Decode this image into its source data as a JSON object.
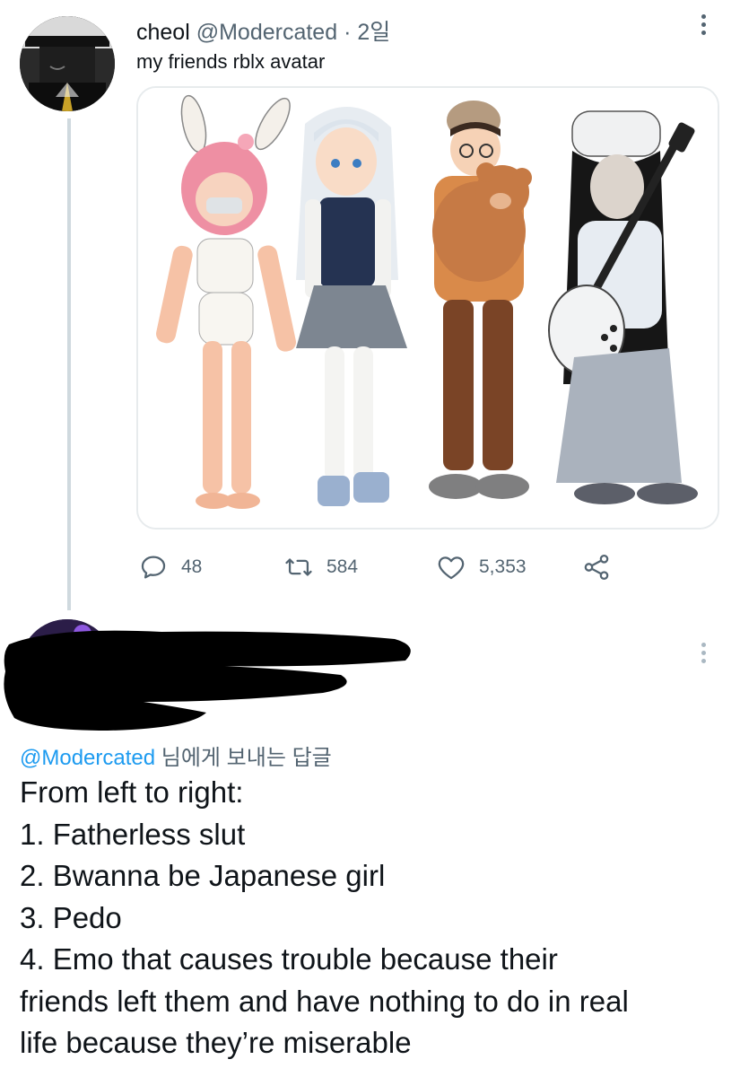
{
  "tweet": {
    "display_name": "cheol",
    "handle": "@Modercated",
    "separator": "·",
    "time": "2일",
    "text": "my friends rblx avatar",
    "media_icon": "illustration-image",
    "actions": {
      "reply_icon": "reply-icon",
      "reply_count": "48",
      "retweet_icon": "retweet-icon",
      "retweet_count": "584",
      "like_icon": "heart-icon",
      "like_count": "5,353",
      "share_icon": "share-icon"
    }
  },
  "reply": {
    "reply_prefix_mention": "@Modercated",
    "reply_prefix_suffix": " 님에게 보내는 답글",
    "lines": [
      "From left to right:",
      "1. Fatherless slut",
      "2. Bwanna be Japanese girl",
      "3. Pedo",
      "4. Emo that causes trouble because their",
      "friends left them and have nothing to do in real",
      "life because they’re miserable"
    ]
  },
  "colors": {
    "text_primary": "#0f1419",
    "text_secondary": "#536471",
    "link": "#1d9bf0",
    "thread_line": "#cfd9de",
    "redaction": "#000000"
  }
}
